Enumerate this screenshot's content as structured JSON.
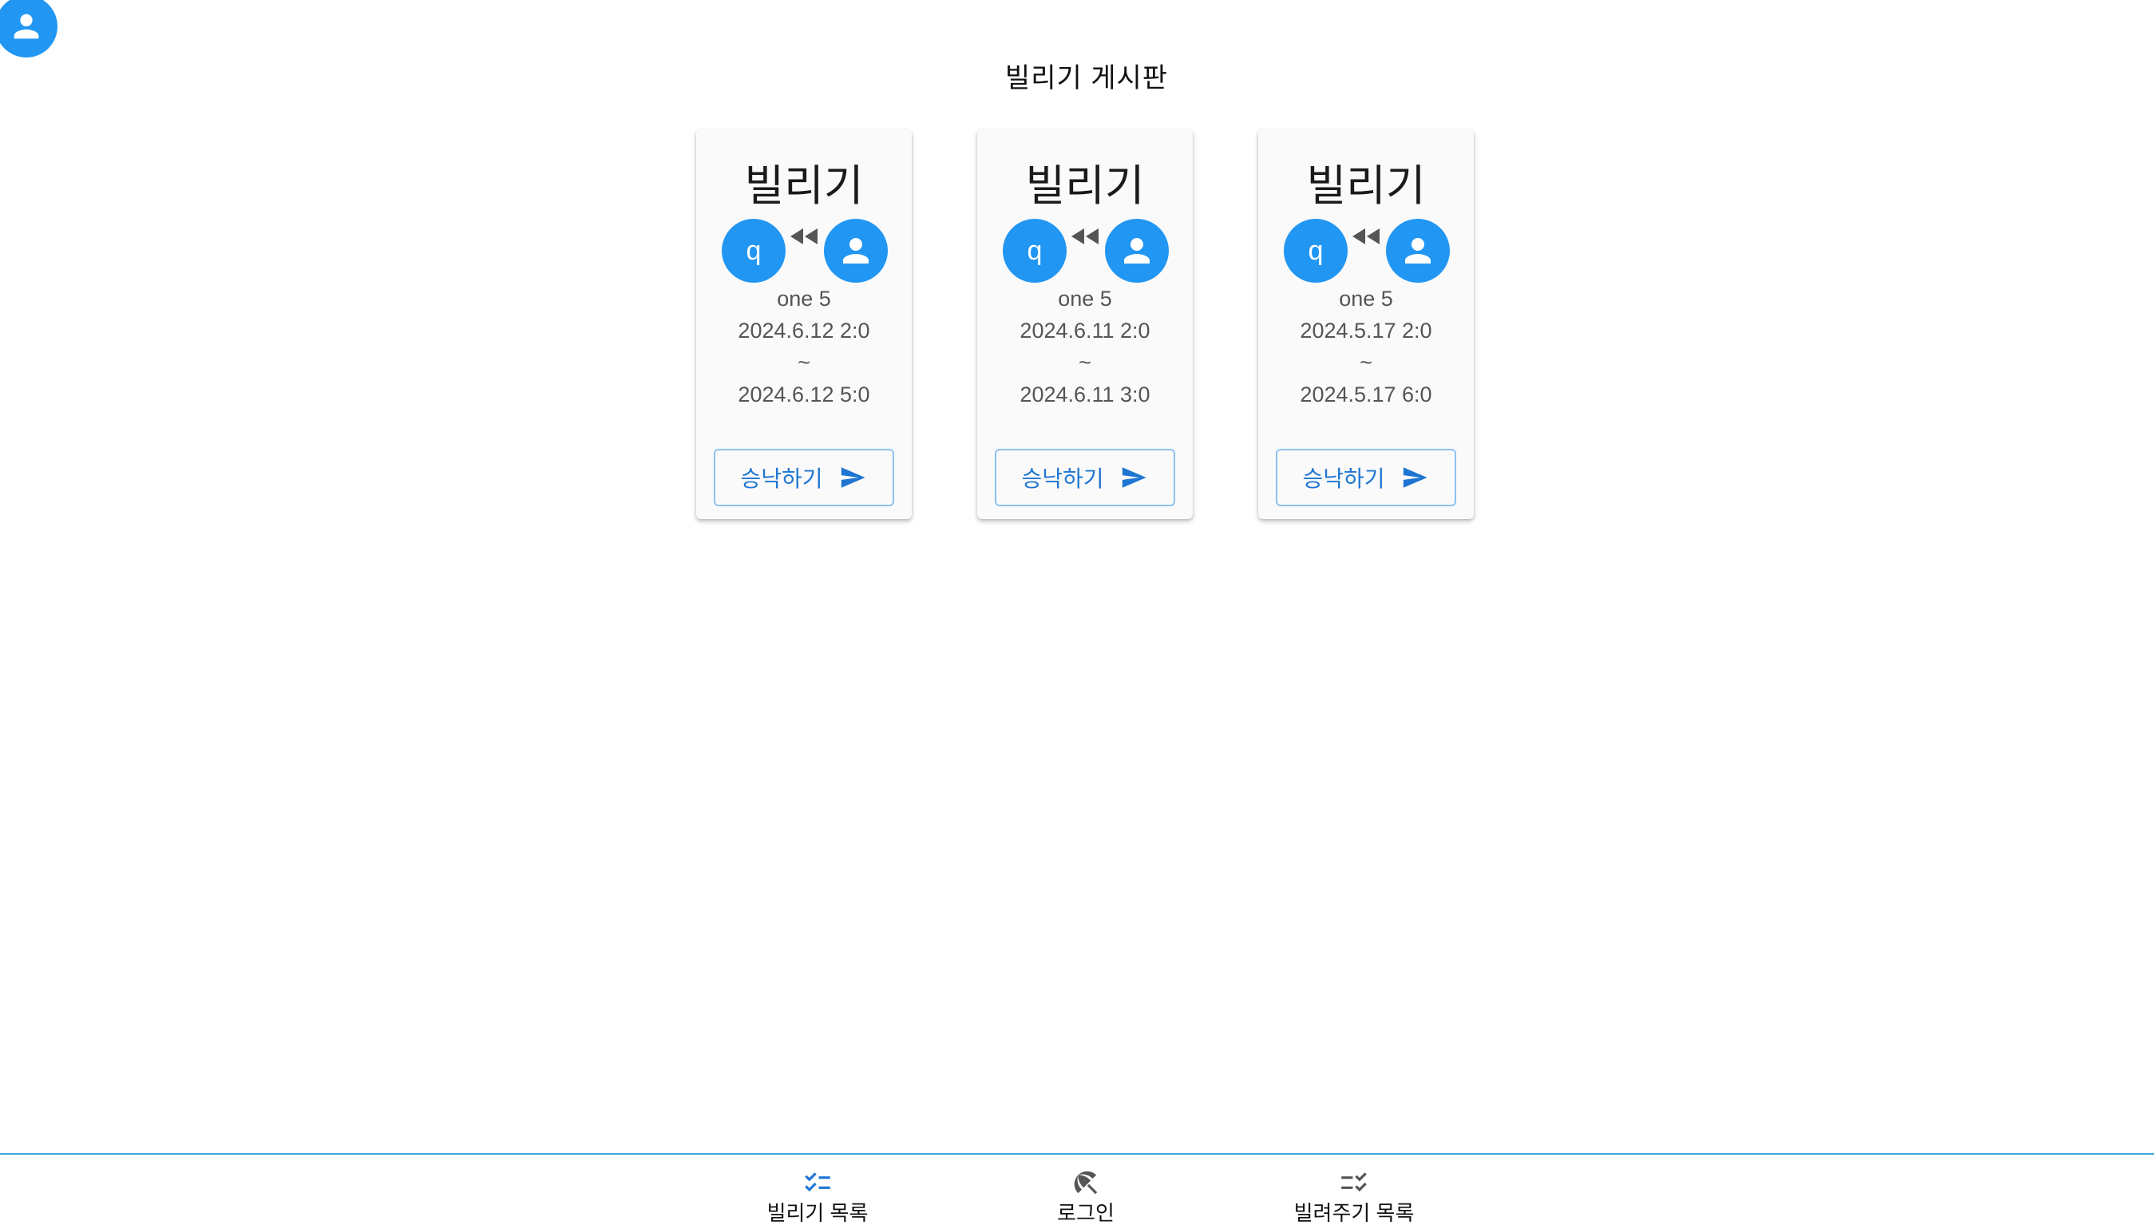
{
  "header": {
    "profile_icon": "account-circle-icon",
    "board_title": "빌리기 게시판"
  },
  "cards": [
    {
      "title": "빌리기",
      "requester_initial": "q",
      "owner": "one 5",
      "start": "2024.6.12 2:0",
      "separator": "~",
      "end": "2024.6.12 5:0",
      "action_label": "승낙하기"
    },
    {
      "title": "빌리기",
      "requester_initial": "q",
      "owner": "one 5",
      "start": "2024.6.11 2:0",
      "separator": "~",
      "end": "2024.6.11 3:0",
      "action_label": "승낙하기"
    },
    {
      "title": "빌리기",
      "requester_initial": "q",
      "owner": "one 5",
      "start": "2024.5.17 2:0",
      "separator": "~",
      "end": "2024.5.17 6:0",
      "action_label": "승낙하기"
    }
  ],
  "bottom_nav": {
    "items": [
      {
        "label": "빌리기 목록",
        "icon": "checklist-icon",
        "active": true
      },
      {
        "label": "로그인",
        "icon": "beach-umbrella-icon",
        "active": false
      },
      {
        "label": "빌려주기 목록",
        "icon": "checklist-rtl-icon",
        "active": false
      }
    ]
  },
  "colors": {
    "accent": "#2196f3",
    "button_text": "#1f76d2",
    "active_nav_icon": "#1f76d2",
    "inactive_nav_icon": "#555555"
  }
}
